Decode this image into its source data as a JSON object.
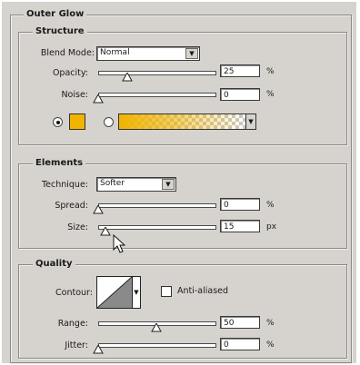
{
  "panel_title": "Outer Glow",
  "structure": {
    "title": "Structure",
    "blend_mode_label": "Blend Mode:",
    "blend_mode_value": "Normal",
    "opacity_label": "Opacity:",
    "opacity_value": "25",
    "opacity_unit": "%",
    "opacity_level": 0.25,
    "noise_label": "Noise:",
    "noise_value": "0",
    "noise_unit": "%",
    "noise_level": 0.0,
    "glow_color": "#f0b400"
  },
  "elements": {
    "title": "Elements",
    "technique_label": "Technique:",
    "technique_value": "Softer",
    "spread_label": "Spread:",
    "spread_value": "0",
    "spread_unit": "%",
    "spread_level": 0.0,
    "size_label": "Size:",
    "size_value": "15",
    "size_unit": "px",
    "size_level": 0.06
  },
  "quality": {
    "title": "Quality",
    "contour_label": "Contour:",
    "anti_aliased_label": "Anti-aliased",
    "anti_aliased_checked": false,
    "range_label": "Range:",
    "range_value": "50",
    "range_unit": "%",
    "range_level": 0.5,
    "jitter_label": "Jitter:",
    "jitter_value": "0",
    "jitter_unit": "%",
    "jitter_level": 0.0
  },
  "icons": {
    "dropdown": "chevron-down-icon",
    "slider_thumb": "triangle-thumb-icon",
    "cursor": "arrow-cursor-icon"
  }
}
